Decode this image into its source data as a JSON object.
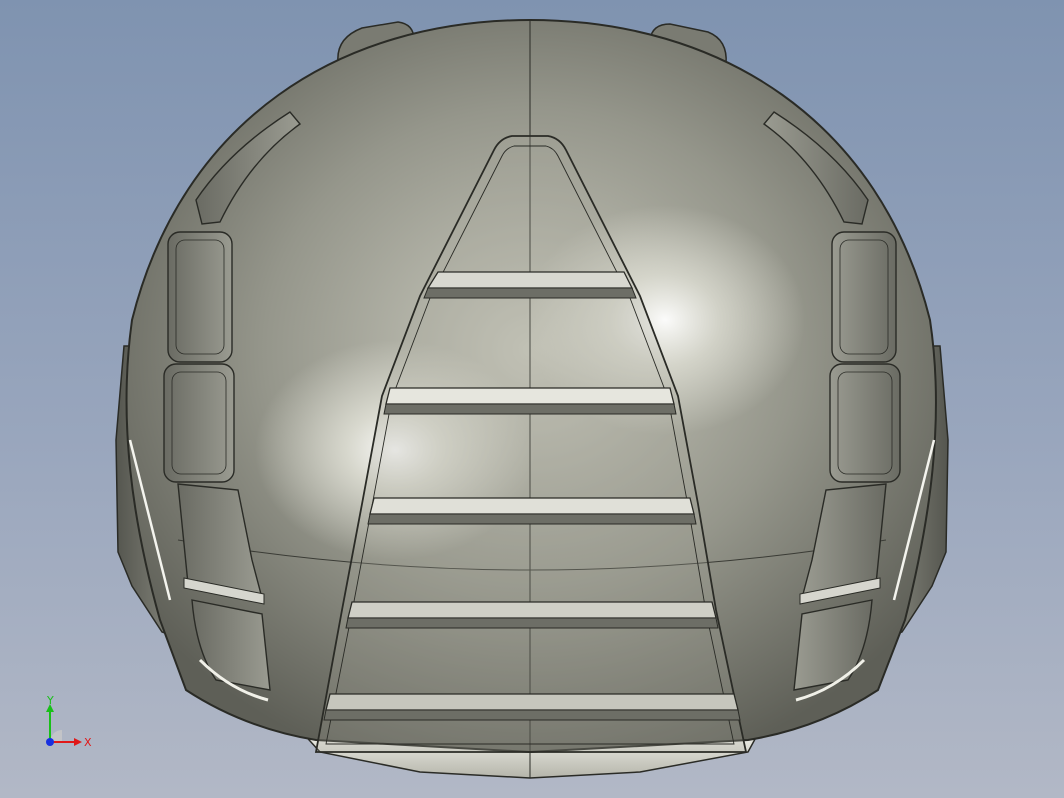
{
  "viewport": {
    "background_top": "#7f93b0",
    "background_bottom": "#b2b8c6"
  },
  "model": {
    "name": "helmet",
    "body_color": "#8e8f84",
    "highlight_color": "#f2f2ea",
    "edge_color": "#2a2b26"
  },
  "triad": {
    "x_label": "X",
    "y_label": "Y",
    "x_color": "#e01818",
    "y_color": "#18c018",
    "z_color": "#1830e0"
  }
}
